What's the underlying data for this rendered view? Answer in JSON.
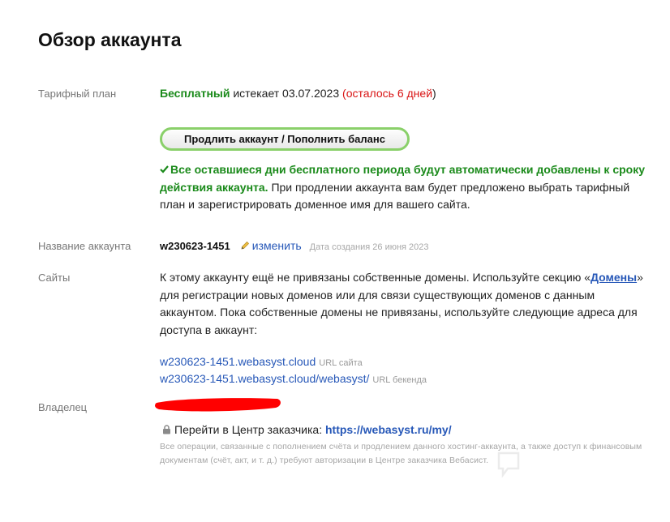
{
  "page": {
    "title": "Обзор аккаунта"
  },
  "plan": {
    "label": "Тарифный план",
    "name": "Бесплатный",
    "expires_prefix": " истекает 03.07.2023 ",
    "paren_open": "(",
    "remaining": "осталось 6 дней",
    "paren_close": ")",
    "extend_button": "Продлить аккаунт / Пополнить баланс",
    "notice_bold": "Все оставшиеся дни бесплатного периода будут автоматически добавлены к сроку действия аккаунта.",
    "notice_rest": " При продлении аккаунта вам будет предложено выбрать тарифный план и зарегистрировать доменное имя для вашего сайта."
  },
  "account": {
    "label": "Название аккаунта",
    "name": "w230623-1451",
    "rename_link": "изменить",
    "created": "Дата создания 26 июня 2023"
  },
  "sites": {
    "label": "Сайты",
    "text_before": "К этому аккаунту ещё не привязаны собственные домены. Используйте секцию «",
    "domains_link": "Домены",
    "text_after": "» для регистрации новых доменов или для связи существующих доменов с данным аккаунтом. Пока собственные домены не привязаны, используйте следующие адреса для доступа в аккаунт:",
    "links": [
      {
        "url": "w230623-1451.webasyst.cloud",
        "note": "URL сайта"
      },
      {
        "url": "w230623-1451.webasyst.cloud/webasyst/",
        "note": "URL бекенда"
      }
    ]
  },
  "owner": {
    "label": "Владелец",
    "customer_prefix": "Перейти в Центр заказчика: ",
    "customer_link": "https://webasyst.ru/my/",
    "fine_print": "Все операции, связанные с пополнением счёта и продлением данного хостинг-аккаунта, а также доступ к финансовым документам (счёт, акт, и т. д.) требуют авторизации в Центре заказчика Вебасист."
  },
  "colors": {
    "green": "#1a8a1a",
    "red": "#d91414",
    "link": "#2758b8",
    "redaction": "#ff0000"
  },
  "icons": [
    "check-icon",
    "pencil-icon",
    "lock-icon"
  ]
}
